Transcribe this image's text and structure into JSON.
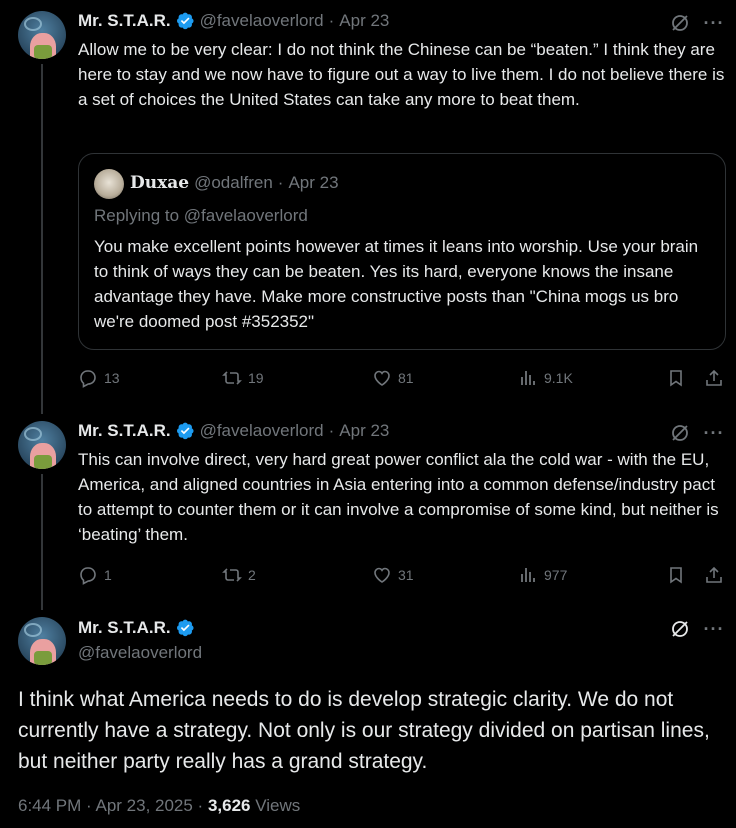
{
  "posts": [
    {
      "name": "Mr. S.T.A.R.",
      "handle": "@favelaoverlord",
      "dot": "·",
      "date": "Apr 23",
      "text": "Allow me to be very clear: I do not think the Chinese can be “beaten.” I think they are here to stay and we now have to figure out a way to live them. I do not believe there is a set of choices the United States can take any more to beat them.",
      "quote": {
        "name": "Duxae",
        "handle": "@odalfren",
        "dot": "·",
        "date": "Apr 23",
        "replying": "Replying to @favelaoverlord",
        "text": "You make excellent points however at times it leans into worship. Use your brain to think of ways they can be beaten. Yes its hard, everyone knows the insane advantage they have. Make more constructive posts than \"China mogs us bro we're doomed post #352352\""
      },
      "stats": {
        "replies": "13",
        "reposts": "19",
        "likes": "81",
        "views": "9.1K"
      }
    },
    {
      "name": "Mr. S.T.A.R.",
      "handle": "@favelaoverlord",
      "dot": "·",
      "date": "Apr 23",
      "text": "This can involve direct, very hard great power conflict ala the cold war - with the EU, America, and aligned countries in Asia entering into a common defense/industry pact to attempt to counter them or it can involve a compromise of some kind, but neither is ‘beating’ them.",
      "stats": {
        "replies": "1",
        "reposts": "2",
        "likes": "31",
        "views": "977"
      }
    },
    {
      "name": "Mr. S.T.A.R.",
      "handle": "@favelaoverlord",
      "text": "I think what America needs to do is develop strategic clarity. We do not currently have a strategy. Not only is our strategy divided on partisan lines, but neither party really has a grand strategy.",
      "time": "6:44 PM · Apr 23, 2025 · ",
      "views_count": "3,626",
      "views_label": " Views"
    }
  ],
  "colors": {
    "background": "#000000",
    "text": "#e7e9ea",
    "muted": "#71767b",
    "verified": "#1d9bf0",
    "border": "#2f3336"
  },
  "icons": [
    "verified-badge-icon",
    "grok-icon",
    "more-icon",
    "reply-icon",
    "repost-icon",
    "like-icon",
    "views-icon",
    "bookmark-icon",
    "share-icon"
  ]
}
